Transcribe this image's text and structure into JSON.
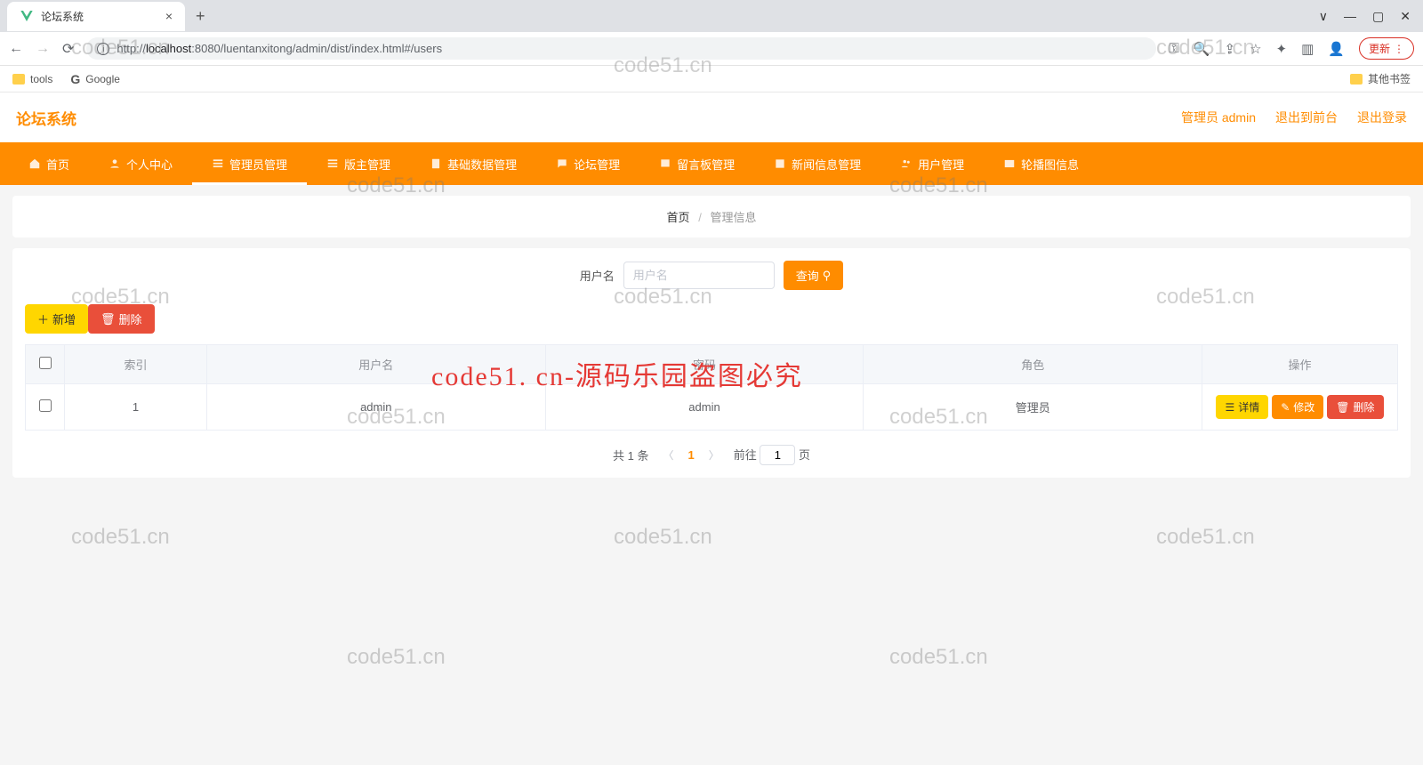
{
  "browser": {
    "tab_title": "论坛系统",
    "url_host": "localhost",
    "url_port": ":8080",
    "url_path": "/luentanxitong/admin/dist/index.html#/users",
    "update_label": "更新"
  },
  "bookmarks": {
    "tools": "tools",
    "google": "Google",
    "other": "其他书签"
  },
  "app": {
    "title": "论坛系统",
    "admin_label": "管理员 admin",
    "exit_front": "退出到前台",
    "logout": "退出登录"
  },
  "nav": {
    "items": [
      "首页",
      "个人中心",
      "管理员管理",
      "版主管理",
      "基础数据管理",
      "论坛管理",
      "留言板管理",
      "新闻信息管理",
      "用户管理",
      "轮播图信息"
    ]
  },
  "breadcrumb": {
    "home": "首页",
    "current": "管理信息"
  },
  "search": {
    "label": "用户名",
    "placeholder": "用户名",
    "query_btn": "查询"
  },
  "actions": {
    "add": "新增",
    "delete": "删除",
    "detail": "详情",
    "modify": "修改"
  },
  "table": {
    "headers": [
      "索引",
      "用户名",
      "密码",
      "角色",
      "操作"
    ],
    "row": {
      "idx": "1",
      "username": "admin",
      "password": "admin",
      "role": "管理员"
    }
  },
  "pagination": {
    "total": "共 1 条",
    "page": "1",
    "goto_prefix": "前往",
    "goto_suffix": "页",
    "goto_value": "1"
  },
  "watermark": {
    "text": "code51.cn",
    "red_text": "code51. cn-源码乐园盗图必究"
  }
}
